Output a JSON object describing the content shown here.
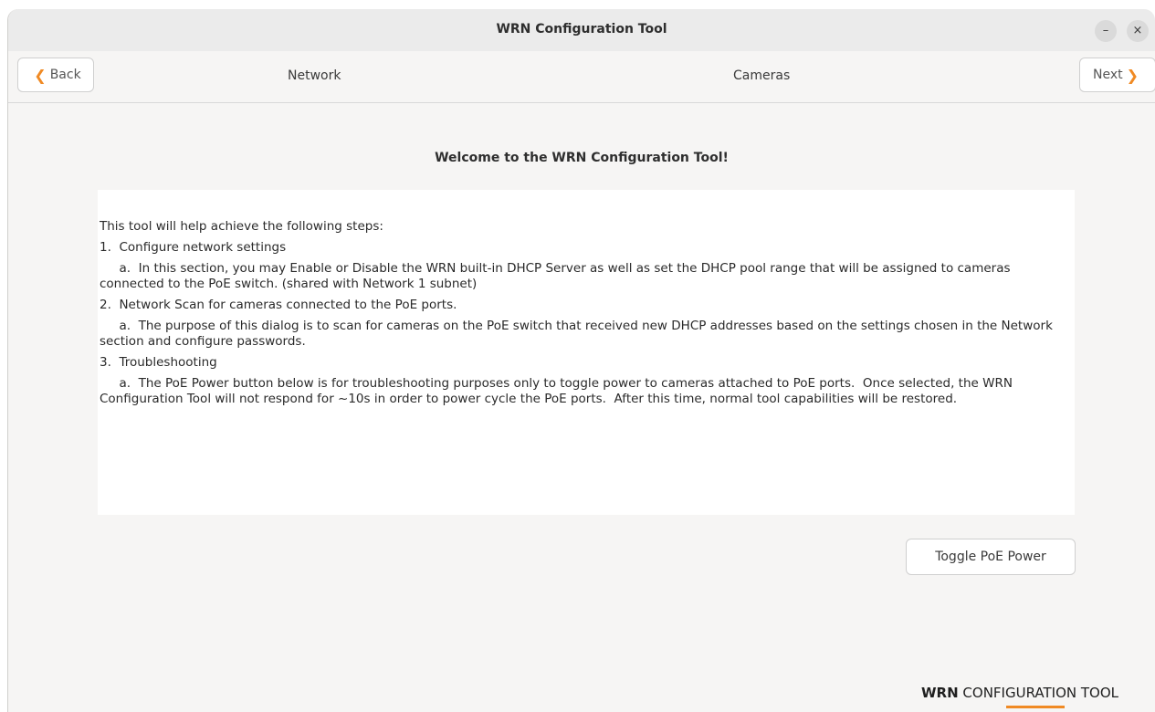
{
  "window": {
    "title": "WRN Configuration Tool",
    "minimize_icon": "–",
    "close_icon": "×"
  },
  "nav": {
    "back_label": "Back",
    "next_label": "Next",
    "back_chevron": "❮",
    "next_chevron": "❯",
    "steps": [
      "Network",
      "Cameras"
    ]
  },
  "main": {
    "heading": "Welcome to the WRN Configuration Tool!",
    "intro": "This tool will help achieve the following steps:",
    "step1": "1.  Configure network settings",
    "step1a": "     a.  In this section, you may Enable or Disable the WRN built-in DHCP Server as well as set the DHCP pool range that will be assigned to cameras connected to the PoE switch. (shared with Network 1 subnet)",
    "step2": "2.  Network Scan for cameras connected to the PoE ports.",
    "step2a": "     a.  The purpose of this dialog is to scan for cameras on the PoE switch that received new DHCP addresses based on the settings chosen in the Network section and configure passwords.",
    "step3": "3.  Troubleshooting",
    "step3a": "     a.  The PoE Power button below is for troubleshooting purposes only to toggle power to cameras attached to PoE ports.  Once selected, the WRN Configuration Tool will not respond for ~10s in order to power cycle the PoE ports.  After this time, normal tool capabilities will be restored.",
    "toggle_label": "Toggle PoE Power"
  },
  "brand": {
    "part1": "WRN",
    "part2": " CONFIGURATION TOOL",
    "accent_color": "#f08a24"
  }
}
